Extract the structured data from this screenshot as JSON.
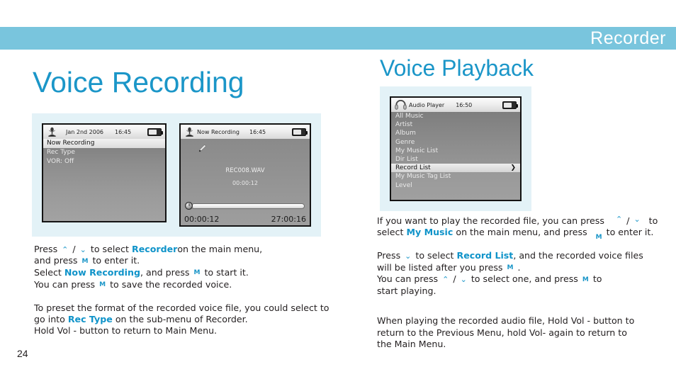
{
  "header": {
    "title": "Recorder",
    "bar_color": "#79c5dd"
  },
  "accent_color": "#1b96c8",
  "page_number": "24",
  "left_column": {
    "heading": "Voice Recording",
    "lcd_menu": {
      "status": {
        "icon": "microphone-icon",
        "date": "Jan 2nd 2006",
        "time": "16:45",
        "battery": "battery-icon"
      },
      "items": [
        {
          "label": "Now Recording",
          "selected": true
        },
        {
          "label": "Rec Type",
          "selected": false
        },
        {
          "label": "VOR: Off",
          "selected": false
        }
      ]
    },
    "lcd_recording": {
      "status": {
        "icon": "microphone-icon",
        "title": "Now Recording",
        "time": "16:45",
        "battery": "battery-icon"
      },
      "pencil_icon": "pencil-icon",
      "list_icon": "playlist-icon",
      "filename": "REC008.WAV",
      "elapsed_center": "00:00:12",
      "elapsed": "00:00:12",
      "remaining": "27:00:16"
    },
    "paragraph1": {
      "line1_a": "Press",
      "line1_btn_up": "⌃",
      "line1_sep": "/",
      "line1_btn_down": "⌄",
      "line1_b": "to select",
      "line1_kw": "Recorder",
      "line1_c": "on the main menu,",
      "line2_a": "and press",
      "line2_btn_m": "M",
      "line2_b": "to enter it.",
      "line3_a": "Select",
      "line3_kw": "Now Recording",
      "line3_b": ", and press",
      "line3_btn_m": "M",
      "line3_c": "to start it.",
      "line4_a": "You can press",
      "line4_btn_m": "M",
      "line4_b": "to save the recorded voice."
    },
    "paragraph2": {
      "line1": "To preset the format of the recorded voice file, you could select to",
      "line2_a": "go into",
      "line2_kw": "Rec Type",
      "line2_b": "on the sub-menu of Recorder.",
      "line3": "Hold Vol - button to return to Main Menu."
    }
  },
  "right_column": {
    "heading": "Voice Playback",
    "lcd_player": {
      "status": {
        "icon": "headphone-icon",
        "title": "Audio Player",
        "time": "16:50",
        "battery": "battery-icon"
      },
      "items": [
        {
          "label": "All Music",
          "selected": false,
          "caret": ""
        },
        {
          "label": "Artist",
          "selected": false,
          "caret": ""
        },
        {
          "label": "Album",
          "selected": false,
          "caret": ""
        },
        {
          "label": "Genre",
          "selected": false,
          "caret": ""
        },
        {
          "label": "My Music List",
          "selected": false,
          "caret": ""
        },
        {
          "label": "Dir List",
          "selected": false,
          "caret": ""
        },
        {
          "label": "Record List",
          "selected": true,
          "caret": "❯"
        },
        {
          "label": "My Music Tag List",
          "selected": false,
          "caret": ""
        },
        {
          "label": "Level",
          "selected": false,
          "caret": ""
        }
      ]
    },
    "paragraph1": {
      "line1_a": "If you want to play the recorded file, you can press",
      "line1_btn_up": "⌃",
      "line1_sep": "/",
      "line1_btn_down": "⌄",
      "line1_b": "to",
      "line2_a": "select",
      "line2_kw": "My Music",
      "line2_b": "on the main menu, and press",
      "line2_btn_m": "M",
      "line2_c": "to enter it."
    },
    "paragraph2": {
      "line1_a": "Press",
      "line1_btn_down": "⌄",
      "line1_b": "to select",
      "line1_kw": "Record List",
      "line1_c": ", and the recorded voice files",
      "line2_a": "will be listed after you press",
      "line2_btn_m": "M",
      "line2_b": ".",
      "line3_a": "You can press",
      "line3_btn_up": "⌃",
      "line3_sep": "/",
      "line3_btn_down": "⌄",
      "line3_b": "to select one, and press",
      "line3_btn_m": "M",
      "line3_c": "to",
      "line4": "start playing."
    },
    "paragraph3": {
      "line1": "When playing the recorded audio file, Hold Vol - button to",
      "line2": "return to the Previous Menu, hold Vol- again to return to",
      "line3": "the Main Menu."
    }
  }
}
